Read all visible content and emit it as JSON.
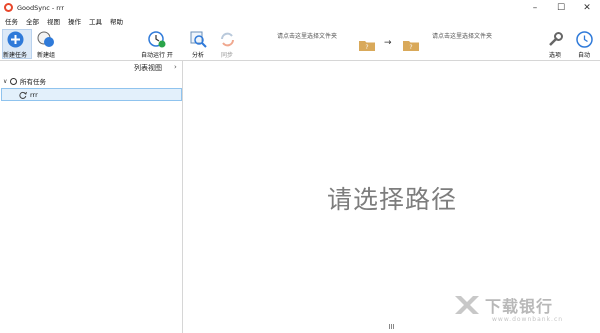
{
  "window": {
    "title": "GoodSync - rrr",
    "controls": [
      "–",
      "☐",
      "✕"
    ]
  },
  "menu": [
    "任务",
    "全部",
    "视图",
    "操作",
    "工具",
    "帮助"
  ],
  "toolbar": {
    "new_job": "新建任务",
    "new_group": "新建组",
    "auto_run": "自动运行 开",
    "analyze": "分析",
    "sync": "同步",
    "options": "选项",
    "auto": "自动",
    "left_path_hint": "请点击这里选择文件夹",
    "right_path_hint": "请点击这里选择文件夹",
    "folder_glyph": "?",
    "arrow_glyph": "→"
  },
  "left_panel": {
    "list_view": "列表视图",
    "list_view_arrow": "›",
    "all_jobs": "所有任务",
    "tree_toggle": "∨",
    "jobs": [
      {
        "name": "rrr"
      }
    ]
  },
  "main_panel": {
    "placeholder": "请选择路径"
  },
  "watermark": {
    "main": "下载银行",
    "sub": "www.downbank.cn"
  },
  "colors": {
    "accent_blue": "#2f7ad9",
    "folder": "#d9a95a",
    "selection_bg": "#e3f0fb",
    "selection_border": "#8fc3ee"
  }
}
